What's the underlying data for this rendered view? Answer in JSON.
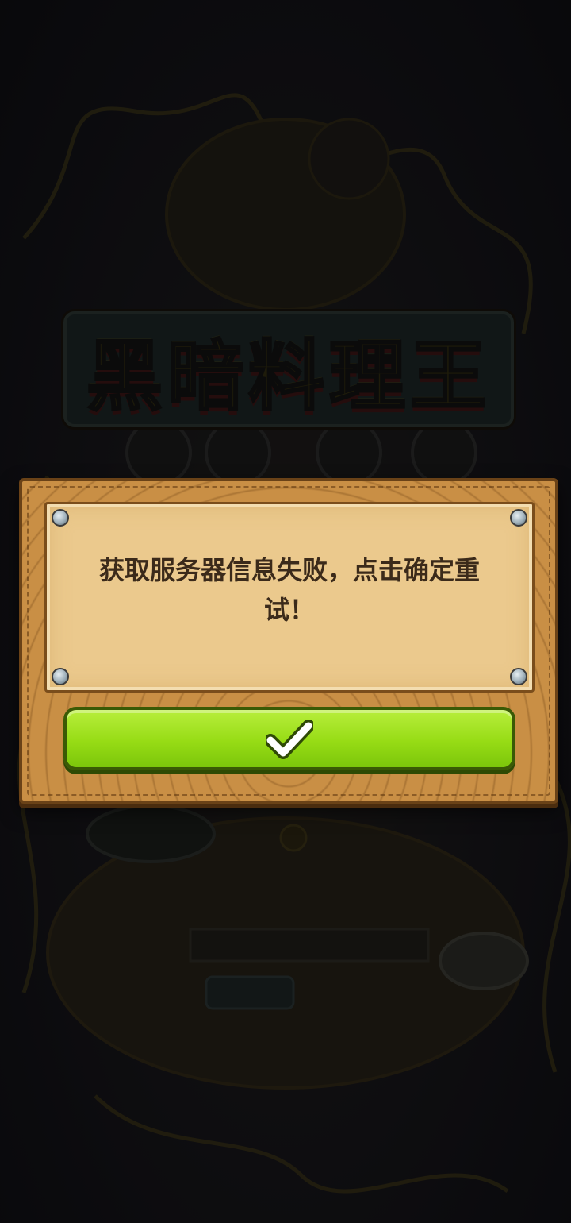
{
  "background": {
    "logo_text": "黑暗料理王"
  },
  "dialog": {
    "message": "获取服务器信息失败，点击确定重试！",
    "confirm_icon": "check-icon"
  },
  "colors": {
    "button_green": "#97dc15",
    "wood": "#c98f45",
    "paper": "#ebc98d",
    "text": "#3b2a1a"
  }
}
